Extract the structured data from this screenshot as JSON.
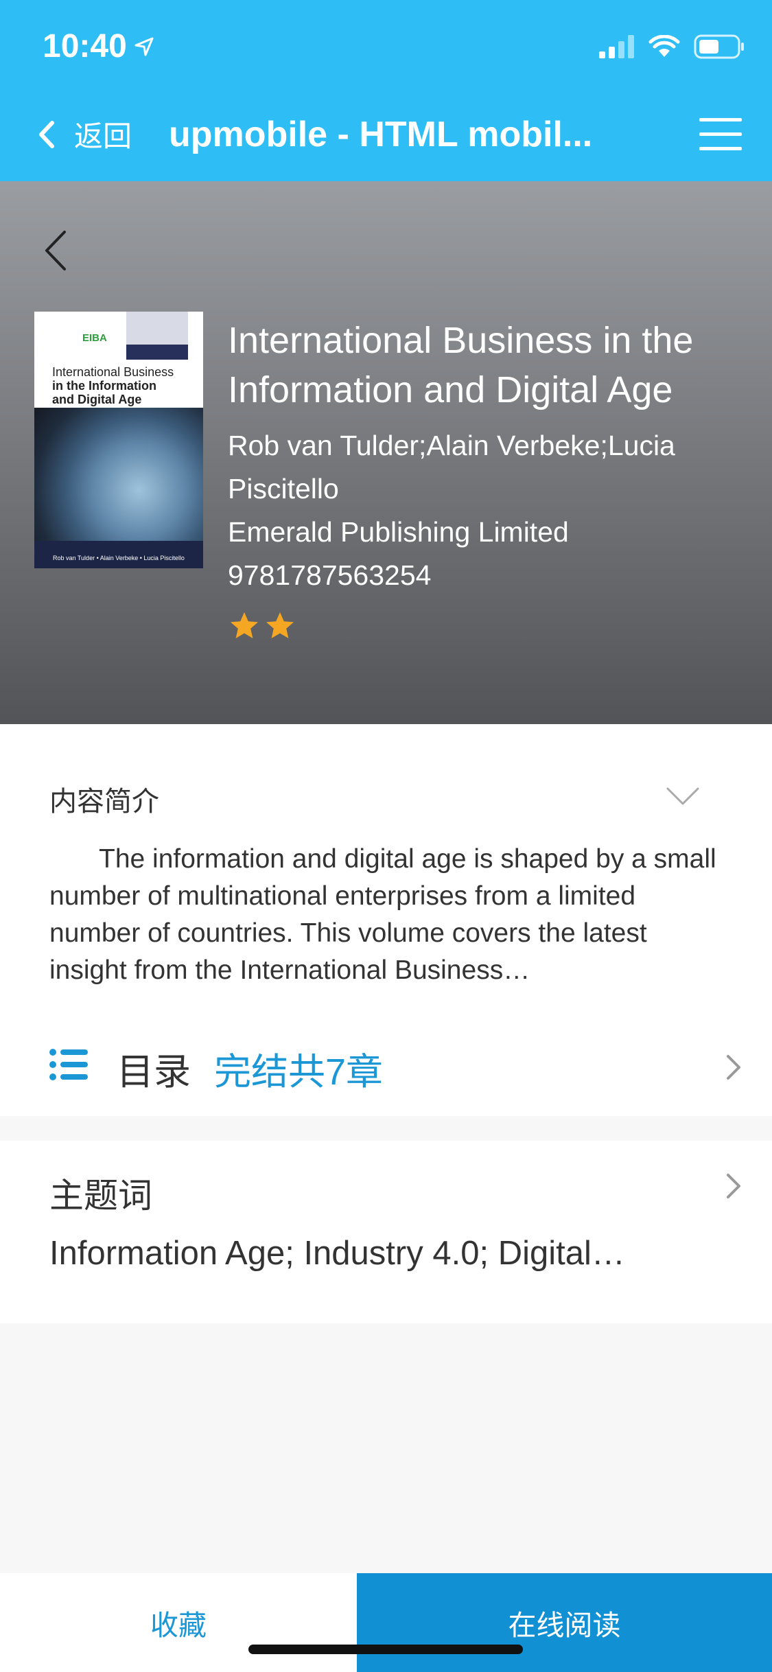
{
  "status_bar": {
    "time": "10:40",
    "icons": [
      "location-arrow-icon",
      "signal-icon",
      "wifi-icon",
      "battery-icon"
    ]
  },
  "nav": {
    "back_label": "返回",
    "title": "upmobile - HTML mobil...",
    "menu_icon": "hamburger-menu-icon"
  },
  "book": {
    "title": "International Business in the Information and Digital Age",
    "authors": "Rob van Tulder;Alain Verbeke;Lucia Piscitello",
    "publisher": "Emerald Publishing Limited",
    "isbn": "9781787563254",
    "rating_stars": 2,
    "cover": {
      "eiba": "EIBA",
      "title_line1": "International Business",
      "title_line2": "in the Information",
      "title_line3": "and Digital Age",
      "authors": "Rob van Tulder • Alain Verbeke • Lucia Piscitello"
    }
  },
  "intro": {
    "label": "内容简介",
    "text": "The information and digital age is shaped by a small number of multinational enterprises from a limited number of countries. This volume covers the latest insight from the International Business…"
  },
  "toc": {
    "label": "目录",
    "status": "完结共7章"
  },
  "keywords": {
    "label": "主题词",
    "text": "Information Age; Industry 4.0; Digital…"
  },
  "actions": {
    "favorite_label": "收藏",
    "read_online_label": "在线阅读"
  },
  "colors": {
    "nav_blue": "#2ebef5",
    "accent_blue": "#1c97d6",
    "read_button_blue": "#1190d4",
    "star_orange": "#f5a623"
  }
}
